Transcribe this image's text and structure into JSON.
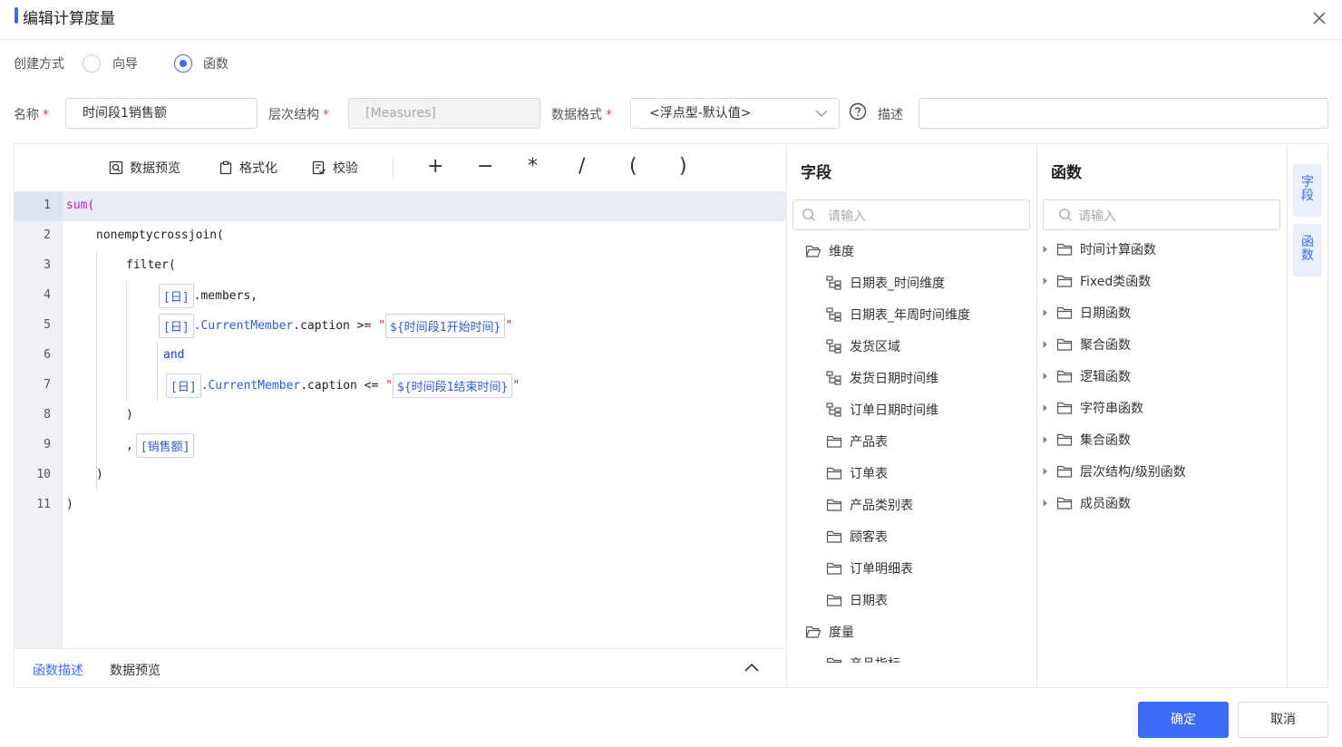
{
  "dialog": {
    "title": "编辑计算度量"
  },
  "creation": {
    "label": "创建方式",
    "options": [
      "向导",
      "函数"
    ],
    "selected": "函数"
  },
  "fields": {
    "name_label": "名称",
    "name_value": "时间段1销售额",
    "hierarchy_label": "层次结构",
    "hierarchy_value": "[Measures]",
    "format_label": "数据格式",
    "format_value": "<浮点型-默认值>",
    "desc_label": "描述",
    "desc_value": "",
    "required_mark": "*"
  },
  "toolbar": {
    "preview": "数据预览",
    "format": "格式化",
    "validate": "校验",
    "ops": [
      "+",
      "−",
      "*",
      "/",
      "(",
      ")"
    ]
  },
  "code": {
    "line_numbers": [
      "1",
      "2",
      "3",
      "4",
      "5",
      "6",
      "7",
      "8",
      "9",
      "10",
      "11"
    ],
    "l1": "sum(",
    "l2": "nonemptycrossjoin(",
    "l3": "filter(",
    "day": "[日]",
    "members": ".members,",
    "current_member": ".CurrentMember",
    "caption": ".caption",
    "ge": " >= ",
    "le": " <= ",
    "quote": "\"",
    "start_param": "${时间段1开始时间}",
    "end_param": "${时间段1结束时间}",
    "and": "and",
    "close_paren": ")",
    "comma": ",",
    "sales": "[销售额]"
  },
  "bottom_tabs": {
    "func_desc": "函数描述",
    "data_preview": "数据预览"
  },
  "field_panel": {
    "title": "字段",
    "search_placeholder": "请输入",
    "dimension_group": "维度",
    "dimension_items": [
      "日期表_时间维度",
      "日期表_年周时间维度",
      "发货区域",
      "发货日期时间维",
      "订单日期时间维"
    ],
    "table_items": [
      "产品表",
      "订单表",
      "产品类别表",
      "顾客表",
      "订单明细表",
      "日期表"
    ],
    "measure_group": "度量",
    "measure_partial": "产品指标"
  },
  "function_panel": {
    "title": "函数",
    "search_placeholder": "请输入",
    "items": [
      "时间计算函数",
      "Fixed类函数",
      "日期函数",
      "聚合函数",
      "逻辑函数",
      "字符串函数",
      "集合函数",
      "层次结构/级别函数",
      "成员函数"
    ]
  },
  "side_tabs": {
    "field": "字段",
    "function": "函数"
  },
  "buttons": {
    "ok": "确定",
    "cancel": "取消"
  },
  "colors": {
    "primary": "#3b6cf6",
    "keyword": "#c41cc8",
    "required": "#e5484d"
  }
}
